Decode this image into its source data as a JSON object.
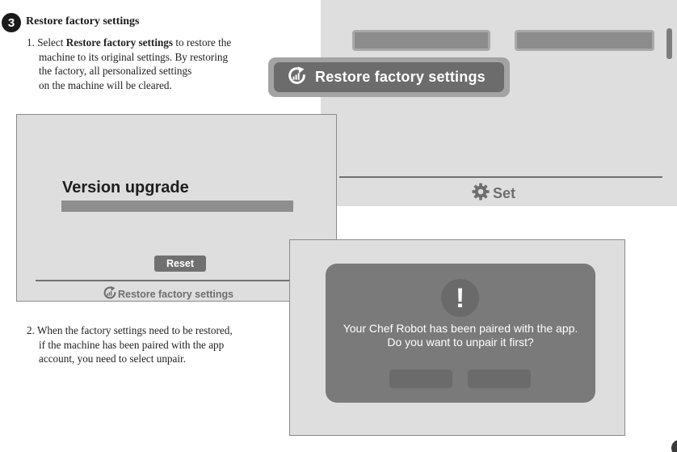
{
  "section": {
    "step_number": "3",
    "title": "Restore factory settings"
  },
  "step1": {
    "number": "1.",
    "text_before": " Select ",
    "bold": "Restore factory settings",
    "text_after": " to restore the",
    "line2": "machine to its original settings. By restoring",
    "line3": "the factory, all personalized settings",
    "line4": "on the machine will be cleared."
  },
  "step2": {
    "line1": "2. When the factory settings need to be restored,",
    "line2": "if the machine has been paired with the app",
    "line3": "account, you need to select unpair."
  },
  "set_screen": {
    "highlight_button_label": "Restore factory settings",
    "highlight_button_icon": "restore-icon",
    "nav_label": "Set",
    "nav_icon": "gear-icon"
  },
  "version_screen": {
    "title": "Version upgrade",
    "reset_button_label": "Reset",
    "nav_label": "Restore factory settings",
    "nav_icon": "restore-icon"
  },
  "unpair_dialog": {
    "alert_symbol": "!",
    "message_line1": "Your Chef Robot has been paired with the app.",
    "message_line2": "Do you want to unpair it first?"
  }
}
